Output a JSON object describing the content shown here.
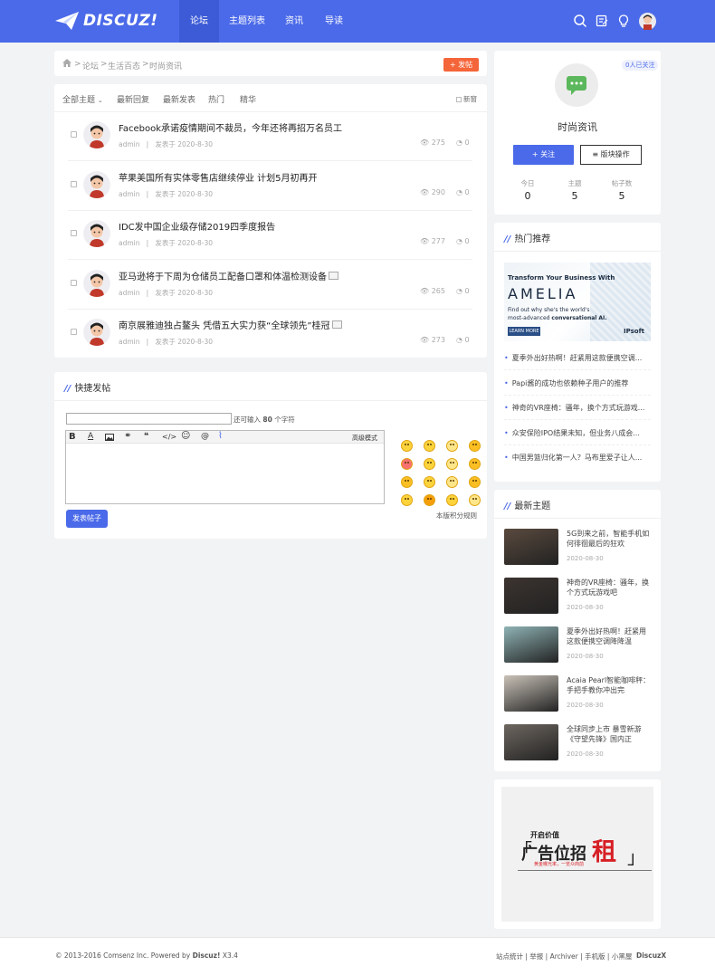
{
  "header": {
    "logo_text": "DISCUZ!",
    "nav": [
      {
        "label": "论坛",
        "active": true
      },
      {
        "label": "主题列表",
        "active": false
      },
      {
        "label": "资讯",
        "active": false
      },
      {
        "label": "导读",
        "active": false
      }
    ],
    "icons": [
      "search-icon",
      "edit-icon",
      "bulb-icon",
      "user-avatar"
    ]
  },
  "breadcrumb": [
    "论坛",
    "生活百态",
    "时尚资讯"
  ],
  "post_button": "+ 发帖",
  "tabs": {
    "items": [
      "全部主题",
      "最新回复",
      "最新发表",
      "热门",
      "精华"
    ],
    "new_window": "新窗"
  },
  "threads": [
    {
      "title": "Facebook承诺疫情期间不裁员，今年还将再招万名员工",
      "author": "admin",
      "date": "发表于 2020-8-30",
      "views": "275",
      "replies": "0",
      "has_image": false
    },
    {
      "title": "苹果美国所有实体零售店继续停业 计划5月初再开",
      "author": "admin",
      "date": "发表于 2020-8-30",
      "views": "290",
      "replies": "0",
      "has_image": false
    },
    {
      "title": "IDC发中国企业级存储2019四季度报告",
      "author": "admin",
      "date": "发表于 2020-8-30",
      "views": "277",
      "replies": "0",
      "has_image": false
    },
    {
      "title": "亚马逊将于下周为仓储员工配备口罩和体温检测设备",
      "author": "admin",
      "date": "发表于 2020-8-30",
      "views": "265",
      "replies": "0",
      "has_image": true
    },
    {
      "title": "南京展雅迪独占鳌头 凭借五大实力获“全球领先”桂冠",
      "author": "admin",
      "date": "发表于 2020-8-30",
      "views": "273",
      "replies": "0",
      "has_image": true
    }
  ],
  "quick_post": {
    "title": "快捷发帖",
    "char_hint_prefix": "还可输入",
    "char_count": "80",
    "char_hint_suffix": "个字符",
    "advanced": "高级模式",
    "submit": "发表帖子",
    "rules": "本版积分规则"
  },
  "forum_info": {
    "followers": "0人已关注",
    "name": "时尚资讯",
    "follow_button": "+ 关注",
    "manage_button": "≡ 版块操作",
    "stats": [
      {
        "label": "今日",
        "value": "0"
      },
      {
        "label": "主题",
        "value": "5"
      },
      {
        "label": "帖子数",
        "value": "5"
      }
    ]
  },
  "hot": {
    "title": "热门推荐",
    "banner": {
      "line1": "Transform Your Business With",
      "brand": "AMELIA",
      "line2": "Find out why she's the world's",
      "line3a": "most-advanced ",
      "line3b": "conversational AI.",
      "cta": "LEARN MORE",
      "logo": "IPsoft"
    },
    "items": [
      "夏季外出好热啊！赶紧用这款便携空调...",
      "Papi酱的成功也依赖种子用户的推荐",
      "神奇的VR座椅：骚年，换个方式玩游戏...",
      "众安保险IPO结果未知，但业务八成会...",
      "中国男篮归化第一人？马布里爱子让人..."
    ]
  },
  "latest": {
    "title": "最新主题",
    "items": [
      {
        "title": "5G到来之前，智能手机如何徘徊最后的狂欢",
        "date": "2020-08-30",
        "thumb_color": "#5a4a3e"
      },
      {
        "title": "神奇的VR座椅：骚年，换个方式玩游戏吧",
        "date": "2020-08-30",
        "thumb_color": "#3c3430"
      },
      {
        "title": "夏季外出好热啊！赶紧用这款便携空调降降温",
        "date": "2020-08-30",
        "thumb_color": "#8fb3b5"
      },
      {
        "title": "Acaia Pearl智能咖啡秤：手把手教你冲出完",
        "date": "2020-08-30",
        "thumb_color": "#c9c2b8"
      },
      {
        "title": "全球同步上市 暴雪新游《守望先锋》国内正",
        "date": "2020-08-30",
        "thumb_color": "#6e6760"
      }
    ]
  },
  "ad": {
    "top": "开启价值",
    "main": "广告位招",
    "big": "租",
    "sub": "黄金曝光率，一览众商前"
  },
  "footer": {
    "left_prefix": "© 2013-2016 Comsenz Inc. Powered by ",
    "brand": "Discuz!",
    "version": " X3.4",
    "links": [
      "站点统计",
      "举报",
      "Archiver",
      "手机版",
      "小黑屋"
    ],
    "right_brand": "DiscuzX"
  },
  "colors": {
    "primary": "#4b6ae9",
    "orange": "#f5653a"
  }
}
